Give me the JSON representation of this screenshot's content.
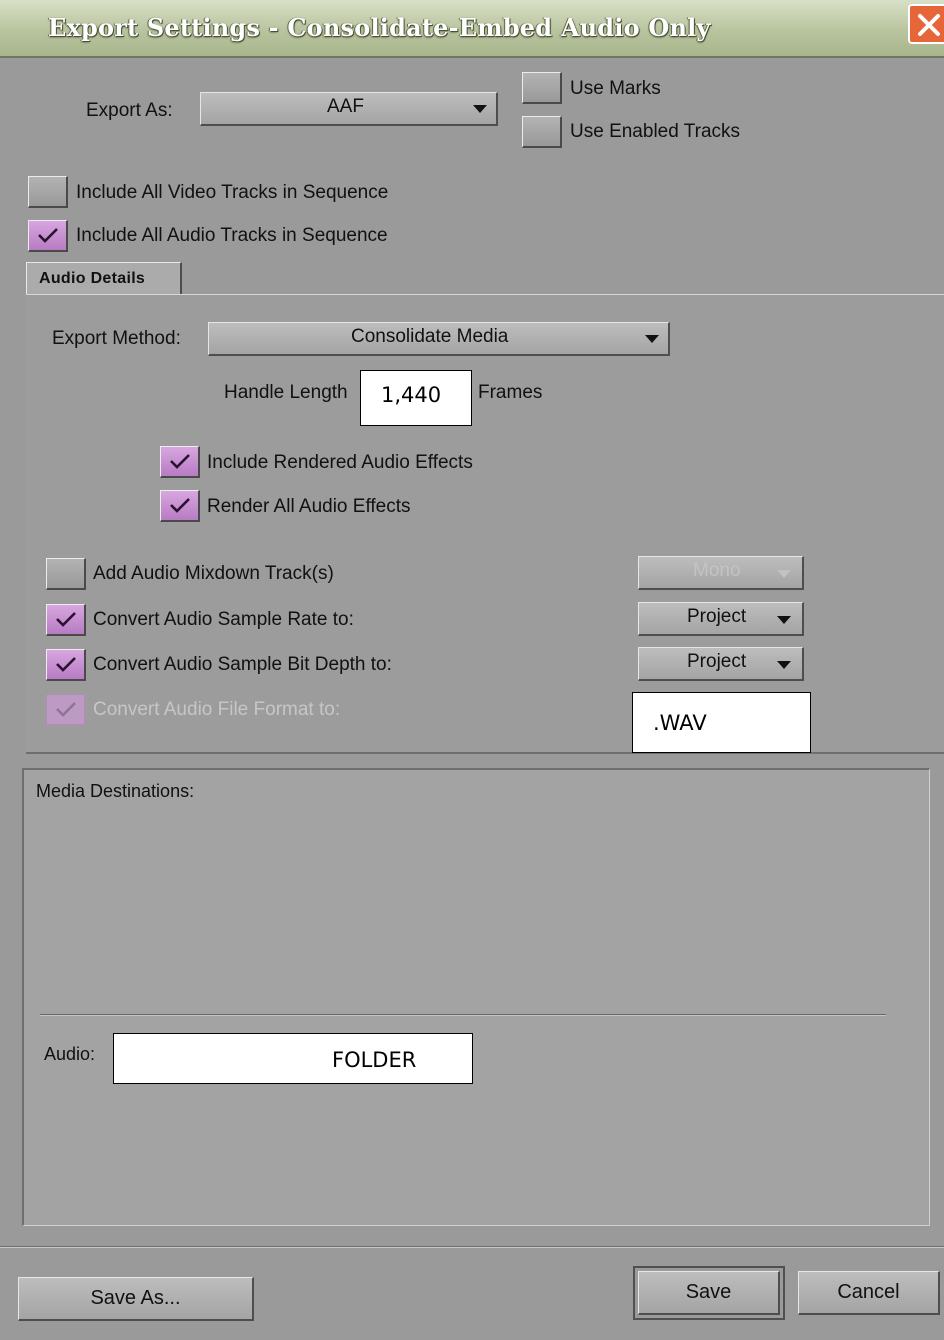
{
  "window": {
    "title": "Export Settings - Consolidate-Embed Audio Only",
    "close_icon": "close-icon"
  },
  "export_as": {
    "label": "Export As:",
    "value": "AAF"
  },
  "use_marks": {
    "label": "Use Marks",
    "checked": false
  },
  "use_enabled_tracks": {
    "label": "Use Enabled Tracks",
    "checked": false
  },
  "include_video": {
    "label": "Include All Video Tracks in Sequence",
    "checked": false
  },
  "include_audio": {
    "label": "Include All Audio Tracks in Sequence",
    "checked": true
  },
  "tabs": [
    {
      "label": "Audio Details",
      "active": true
    }
  ],
  "audio_details": {
    "export_method_label": "Export Method:",
    "export_method_value": "Consolidate Media",
    "handle_length_label": "Handle Length",
    "handle_length_value": "1,440",
    "frames_label": "Frames",
    "include_rendered": {
      "label": "Include Rendered Audio Effects",
      "checked": true
    },
    "render_all": {
      "label": "Render All Audio Effects",
      "checked": true
    },
    "mixdown": {
      "label": "Add Audio Mixdown Track(s)",
      "checked": false,
      "option": "Mono",
      "enabled": false
    },
    "sample_rate": {
      "label": "Convert Audio Sample Rate to:",
      "checked": true,
      "option": "Project"
    },
    "bit_depth": {
      "label": "Convert Audio Sample Bit Depth to:",
      "checked": true,
      "option": "Project"
    },
    "file_format": {
      "label": "Convert Audio File Format to:",
      "checked": true,
      "enabled": false,
      "value": ".WAV"
    }
  },
  "media_destinations": {
    "label": "Media Destinations:",
    "audio_label": "Audio:",
    "audio_value": "FOLDER"
  },
  "footer": {
    "save_as": "Save As...",
    "save": "Save",
    "cancel": "Cancel"
  },
  "colors": {
    "checked": "#b77cc3",
    "titlebar": "#b8c49e",
    "background": "#9a9a9a"
  }
}
